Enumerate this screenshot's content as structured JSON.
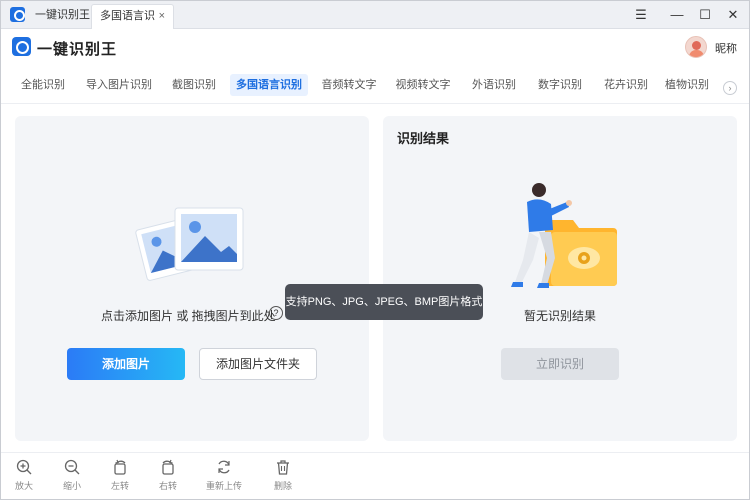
{
  "titlebar": {
    "tabs": [
      {
        "label": "一键识别王"
      },
      {
        "label": "多国语言识别",
        "close": "×"
      }
    ],
    "window_controls": {
      "menu": "☰",
      "minimize": "—",
      "maximize": "☐",
      "close": "✕"
    }
  },
  "header": {
    "app_name": "一键识别王",
    "nickname": "昵称"
  },
  "nav": {
    "items": [
      {
        "label": "全能识别"
      },
      {
        "label": "导入图片识别"
      },
      {
        "label": "截图识别"
      },
      {
        "label": "多国语言识别",
        "active": true
      },
      {
        "label": "音频转文字"
      },
      {
        "label": "视频转文字"
      },
      {
        "label": "外语识别"
      },
      {
        "label": "数字识别"
      },
      {
        "label": "花卉识别"
      },
      {
        "label": "植物识别"
      }
    ],
    "more_glyph": "›"
  },
  "left_panel": {
    "upload_hint": "点击添加图片 或 拖拽图片到此处",
    "help_glyph": "?",
    "add_image_button": "添加图片",
    "add_folder_button": "添加图片文件夹"
  },
  "right_panel": {
    "title": "识别结果",
    "empty_text": "暂无识别结果",
    "recognize_button": "立即识别"
  },
  "tooltip": {
    "text": "支持PNG、JPG、JPEG、BMP图片格式"
  },
  "toolbar": {
    "items": [
      {
        "label": "放大",
        "icon": "zoom-in-icon"
      },
      {
        "label": "缩小",
        "icon": "zoom-out-icon"
      },
      {
        "label": "左转",
        "icon": "rotate-left-icon"
      },
      {
        "label": "右转",
        "icon": "rotate-right-icon"
      },
      {
        "label": "重新上传",
        "icon": "reupload-icon"
      },
      {
        "label": "删除",
        "icon": "trash-icon"
      }
    ]
  },
  "colors": {
    "accent": "#1e6fe0",
    "button_gradient_start": "#2b7bf6",
    "button_gradient_end": "#26b8f5",
    "panel_bg": "#f3f5f8",
    "tooltip_bg": "#4b4f57",
    "folder": "#ffc94d"
  }
}
